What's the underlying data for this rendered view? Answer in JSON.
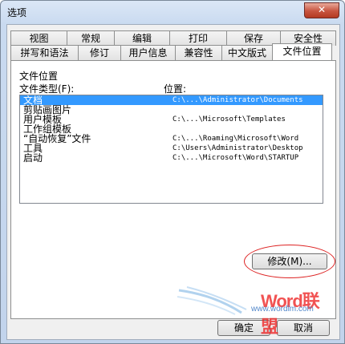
{
  "window": {
    "title": "选项",
    "close_glyph": "✕"
  },
  "tabs_row1": [
    "视图",
    "常规",
    "编辑",
    "打印",
    "保存",
    "安全性"
  ],
  "tabs_row2": [
    "拼写和语法",
    "修订",
    "用户信息",
    "兼容性",
    "中文版式",
    "文件位置"
  ],
  "active_tab": "文件位置",
  "panel": {
    "group_label": "文件位置",
    "col_type_header": "文件类型(F):",
    "col_location_header": "位置:",
    "rows": [
      {
        "type": "文档",
        "location": "C:\\...\\Administrator\\Documents",
        "selected": true
      },
      {
        "type": "剪贴画图片",
        "location": "",
        "selected": false
      },
      {
        "type": "用户模板",
        "location": "C:\\...\\Microsoft\\Templates",
        "selected": false
      },
      {
        "type": "工作组模板",
        "location": "",
        "selected": false
      },
      {
        "type": "“自动恢复”文件",
        "location": "C:\\...\\Roaming\\Microsoft\\Word",
        "selected": false
      },
      {
        "type": "工具",
        "location": "C:\\Users\\Administrator\\Desktop",
        "selected": false
      },
      {
        "type": "启动",
        "location": "C:\\...\\Microsoft\\Word\\STARTUP",
        "selected": false
      }
    ],
    "modify_button": "修改(M)..."
  },
  "footer": {
    "ok_button": "确定",
    "cancel_button": "取消"
  },
  "watermark": {
    "text": "Word联盟",
    "url": "www.wordlm.com"
  }
}
